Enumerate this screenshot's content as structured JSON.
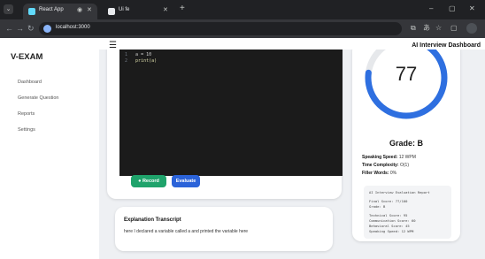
{
  "browser": {
    "tabs": [
      {
        "title": "React App",
        "active": true
      },
      {
        "title": "Ui fe",
        "active": false
      }
    ],
    "new_tab": "+",
    "url": "localhost:3000",
    "window_controls": [
      "–",
      "▢",
      "✕"
    ]
  },
  "app": {
    "header_title": "AI Interview Dashboard",
    "brand": "V-EXAM",
    "sidebar": {
      "items": [
        {
          "label": "Dashboard"
        },
        {
          "label": "Generate Question"
        },
        {
          "label": "Reports"
        },
        {
          "label": "Settings"
        }
      ]
    },
    "editor": {
      "lines": [
        {
          "num": "1",
          "code": "a = 10"
        },
        {
          "num": "2",
          "code": "print(a)"
        }
      ]
    },
    "buttons": {
      "record": "● Record",
      "evaluate": "Evaluate"
    },
    "transcript": {
      "title": "Explanation Transcript",
      "text": "here I declared a variable called a and printed the variable here"
    },
    "results": {
      "score": "77",
      "score_fraction": 0.77,
      "grade": "Grade: B",
      "stats": [
        {
          "label": "Speaking Speed:",
          "value": "12 WPM"
        },
        {
          "label": "Time Complexity:",
          "value": "O(1)"
        },
        {
          "label": "Filler Words:",
          "value": "0%"
        }
      ],
      "report": {
        "title": "AI Interview Evaluation Report",
        "lines": [
          "Final Score: 77/100",
          "Grade: B",
          "Technical Score: 95",
          "Communication Score: 60",
          "Behavioral Score: 45",
          "Speaking Speed: 12 WPM"
        ]
      }
    }
  },
  "colors": {
    "gauge": "#2e6fe0",
    "record": "#1fa36b",
    "evaluate": "#2b63d9",
    "editor_bg": "#1b1b1b"
  }
}
